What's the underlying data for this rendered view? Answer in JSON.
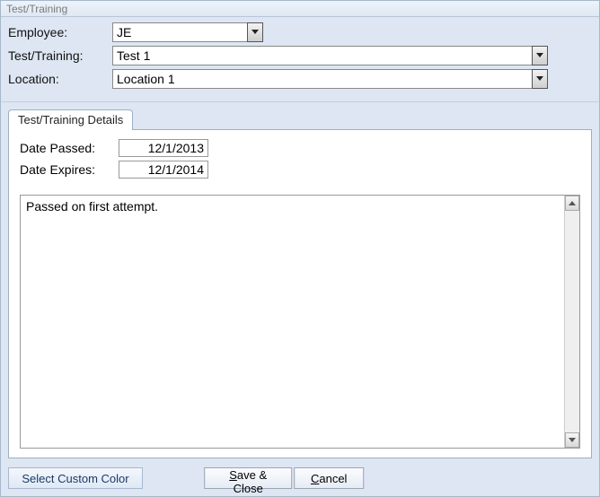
{
  "window": {
    "title": "Test/Training"
  },
  "header": {
    "employee_label": "Employee:",
    "employee_value": "JE",
    "testtraining_label": "Test/Training:",
    "testtraining_value": "Test 1",
    "location_label": "Location:",
    "location_value": "Location 1"
  },
  "tab": {
    "details_label": "Test/Training Details"
  },
  "details": {
    "date_passed_label": "Date Passed:",
    "date_passed_value": "12/1/2013",
    "date_expires_label": "Date Expires:",
    "date_expires_value": "12/1/2014",
    "notes": "Passed on first attempt."
  },
  "footer": {
    "custom_color": "Select Custom Color",
    "save_prefix": "S",
    "save_rest": "ave & Close",
    "cancel_prefix": "C",
    "cancel_rest": "ancel"
  }
}
